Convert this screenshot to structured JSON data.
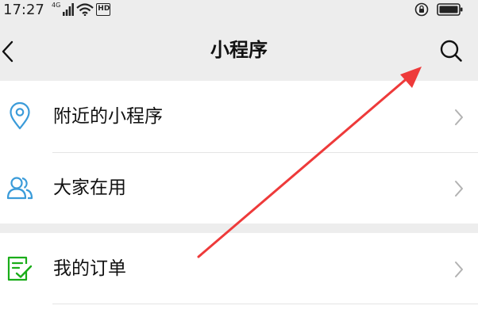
{
  "status_bar": {
    "time": "17:27",
    "network": "4G",
    "hd_label": "HD",
    "icons": [
      "signal-icon",
      "wifi-icon",
      "hd-icon",
      "lock-rotation-icon",
      "battery-icon"
    ]
  },
  "header": {
    "title": "小程序",
    "back_icon": "chevron-left-icon",
    "search_icon": "search-icon"
  },
  "menu": {
    "items": [
      {
        "label": "附近的小程序",
        "icon": "location-pin-icon"
      },
      {
        "label": "大家在用",
        "icon": "people-icon"
      },
      {
        "label": "我的订单",
        "icon": "order-list-icon"
      }
    ]
  },
  "colors": {
    "background": "#ededed",
    "row_bg": "#ffffff",
    "icon_blue": "#3a9bd9",
    "icon_green": "#1aad19",
    "annotation_red": "#ee3a3a"
  }
}
